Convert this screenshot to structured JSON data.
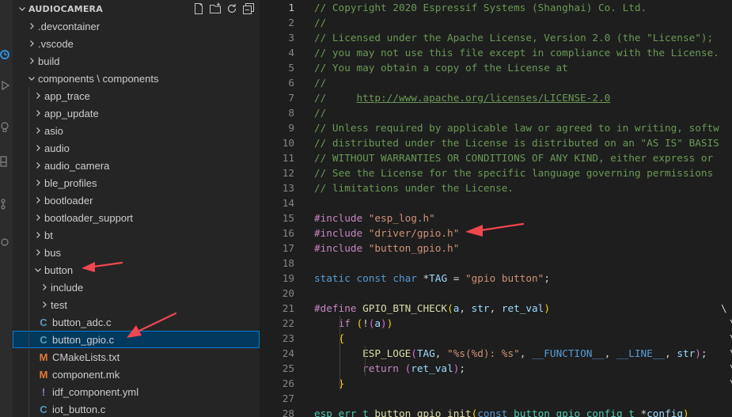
{
  "explorer": {
    "title": "AUDIOCAMERA",
    "actions": [
      "new-file-icon",
      "new-folder-icon",
      "refresh-icon",
      "collapse-all-icon"
    ],
    "items": [
      {
        "label": ".devcontainer",
        "depth": 0,
        "kind": "folder",
        "open": false
      },
      {
        "label": ".vscode",
        "depth": 0,
        "kind": "folder",
        "open": false
      },
      {
        "label": "build",
        "depth": 0,
        "kind": "folder",
        "open": false
      },
      {
        "label": "components \\ components",
        "depth": 0,
        "kind": "folder",
        "open": true
      },
      {
        "label": "app_trace",
        "depth": 1,
        "kind": "folder",
        "open": false
      },
      {
        "label": "app_update",
        "depth": 1,
        "kind": "folder",
        "open": false
      },
      {
        "label": "asio",
        "depth": 1,
        "kind": "folder",
        "open": false
      },
      {
        "label": "audio",
        "depth": 1,
        "kind": "folder",
        "open": false
      },
      {
        "label": "audio_camera",
        "depth": 1,
        "kind": "folder",
        "open": false
      },
      {
        "label": "ble_profiles",
        "depth": 1,
        "kind": "folder",
        "open": false
      },
      {
        "label": "bootloader",
        "depth": 1,
        "kind": "folder",
        "open": false
      },
      {
        "label": "bootloader_support",
        "depth": 1,
        "kind": "folder",
        "open": false
      },
      {
        "label": "bt",
        "depth": 1,
        "kind": "folder",
        "open": false
      },
      {
        "label": "bus",
        "depth": 1,
        "kind": "folder",
        "open": false
      },
      {
        "label": "button",
        "depth": 1,
        "kind": "folder",
        "open": true
      },
      {
        "label": "include",
        "depth": 2,
        "kind": "folder",
        "open": false
      },
      {
        "label": "test",
        "depth": 2,
        "kind": "folder",
        "open": false
      },
      {
        "label": "button_adc.c",
        "depth": 2,
        "kind": "file",
        "icon": "C",
        "icon_color": "#519aba"
      },
      {
        "label": "button_gpio.c",
        "depth": 2,
        "kind": "file",
        "icon": "C",
        "icon_color": "#519aba",
        "selected": true
      },
      {
        "label": "CMakeLists.txt",
        "depth": 2,
        "kind": "file",
        "icon": "M",
        "icon_color": "#e37933"
      },
      {
        "label": "component.mk",
        "depth": 2,
        "kind": "file",
        "icon": "M",
        "icon_color": "#e37933"
      },
      {
        "label": "idf_component.yml",
        "depth": 2,
        "kind": "file",
        "icon": "!",
        "icon_color": "#a074c4"
      },
      {
        "label": "iot_button.c",
        "depth": 2,
        "kind": "file",
        "icon": "C",
        "icon_color": "#519aba"
      }
    ]
  },
  "editor": {
    "active_line": 1,
    "lines": [
      {
        "n": "1",
        "tokens": [
          {
            "t": "// Copyright 2020 Espressif Systems (Shanghai) Co. Ltd.",
            "c": "comment"
          }
        ]
      },
      {
        "n": "2",
        "tokens": [
          {
            "t": "//",
            "c": "comment"
          }
        ]
      },
      {
        "n": "3",
        "tokens": [
          {
            "t": "// Licensed under the Apache License, Version 2.0 (the \"License\");",
            "c": "comment"
          }
        ]
      },
      {
        "n": "4",
        "tokens": [
          {
            "t": "// you may not use this file except in compliance with the License.",
            "c": "comment"
          }
        ]
      },
      {
        "n": "5",
        "tokens": [
          {
            "t": "// You may obtain a copy of the License at",
            "c": "comment"
          }
        ]
      },
      {
        "n": "6",
        "tokens": [
          {
            "t": "//",
            "c": "comment"
          }
        ]
      },
      {
        "n": "7",
        "tokens": [
          {
            "t": "//     ",
            "c": "comment"
          },
          {
            "t": "http://www.apache.org/licenses/LICENSE-2.0",
            "c": "link"
          }
        ]
      },
      {
        "n": "8",
        "tokens": [
          {
            "t": "//",
            "c": "comment"
          }
        ]
      },
      {
        "n": "9",
        "tokens": [
          {
            "t": "// Unless required by applicable law or agreed to in writing, softw",
            "c": "comment"
          }
        ]
      },
      {
        "n": "10",
        "tokens": [
          {
            "t": "// distributed under the License is distributed on an \"AS IS\" BASIS",
            "c": "comment"
          }
        ]
      },
      {
        "n": "11",
        "tokens": [
          {
            "t": "// WITHOUT WARRANTIES OR CONDITIONS OF ANY KIND, either express or",
            "c": "comment"
          }
        ]
      },
      {
        "n": "12",
        "tokens": [
          {
            "t": "// See the License for the specific language governing permissions",
            "c": "comment"
          }
        ]
      },
      {
        "n": "13",
        "tokens": [
          {
            "t": "// limitations under the License.",
            "c": "comment"
          }
        ]
      },
      {
        "n": "14",
        "tokens": []
      },
      {
        "n": "15",
        "tokens": [
          {
            "t": "#include",
            "c": "macro"
          },
          {
            "t": " ",
            "c": "plain"
          },
          {
            "t": "\"esp_log.h\"",
            "c": "string"
          }
        ]
      },
      {
        "n": "16",
        "tokens": [
          {
            "t": "#include",
            "c": "macro"
          },
          {
            "t": " ",
            "c": "plain"
          },
          {
            "t": "\"driver/gpio.h\"",
            "c": "string"
          }
        ]
      },
      {
        "n": "17",
        "tokens": [
          {
            "t": "#include",
            "c": "macro"
          },
          {
            "t": " ",
            "c": "plain"
          },
          {
            "t": "\"button_gpio.h\"",
            "c": "string"
          }
        ]
      },
      {
        "n": "18",
        "tokens": []
      },
      {
        "n": "19",
        "tokens": [
          {
            "t": "static",
            "c": "keyword"
          },
          {
            "t": " ",
            "c": "plain"
          },
          {
            "t": "const",
            "c": "keyword"
          },
          {
            "t": " ",
            "c": "plain"
          },
          {
            "t": "char",
            "c": "keyword"
          },
          {
            "t": " *",
            "c": "plain"
          },
          {
            "t": "TAG",
            "c": "var"
          },
          {
            "t": " = ",
            "c": "plain"
          },
          {
            "t": "\"gpio button\"",
            "c": "string"
          },
          {
            "t": ";",
            "c": "plain"
          }
        ]
      },
      {
        "n": "20",
        "tokens": []
      },
      {
        "n": "21",
        "tokens": [
          {
            "t": "#define",
            "c": "macro"
          },
          {
            "t": " ",
            "c": "plain"
          },
          {
            "t": "GPIO_BTN_CHECK",
            "c": "func"
          },
          {
            "t": "(",
            "c": "bracket1"
          },
          {
            "t": "a",
            "c": "var"
          },
          {
            "t": ", ",
            "c": "plain"
          },
          {
            "t": "str",
            "c": "var"
          },
          {
            "t": ", ",
            "c": "plain"
          },
          {
            "t": "ret_val",
            "c": "var"
          },
          {
            "t": ")",
            "c": "bracket1"
          }
        ]
      },
      {
        "n": "22",
        "tokens": [
          {
            "t": "    ",
            "c": "plain"
          },
          {
            "t": "if",
            "c": "macro"
          },
          {
            "t": " ",
            "c": "plain"
          },
          {
            "t": "(",
            "c": "bracket1"
          },
          {
            "t": "!",
            "c": "plain"
          },
          {
            "t": "(",
            "c": "bracket2"
          },
          {
            "t": "a",
            "c": "var"
          },
          {
            "t": ")",
            "c": "bracket2"
          },
          {
            "t": ")",
            "c": "bracket1"
          }
        ]
      },
      {
        "n": "23",
        "tokens": [
          {
            "t": "    ",
            "c": "plain"
          },
          {
            "t": "{",
            "c": "bracket1"
          }
        ]
      },
      {
        "n": "24",
        "tokens": [
          {
            "t": "        ",
            "c": "plain"
          },
          {
            "t": "ESP_LOGE",
            "c": "func"
          },
          {
            "t": "(",
            "c": "bracket2"
          },
          {
            "t": "TAG",
            "c": "var"
          },
          {
            "t": ", ",
            "c": "plain"
          },
          {
            "t": "\"%s(%d): %s\"",
            "c": "string"
          },
          {
            "t": ", ",
            "c": "plain"
          },
          {
            "t": "__FUNCTION__",
            "c": "keyword"
          },
          {
            "t": ", ",
            "c": "plain"
          },
          {
            "t": "__LINE__",
            "c": "keyword"
          },
          {
            "t": ", ",
            "c": "plain"
          },
          {
            "t": "str",
            "c": "var"
          },
          {
            "t": ")",
            "c": "bracket2"
          },
          {
            "t": ";",
            "c": "plain"
          }
        ]
      },
      {
        "n": "25",
        "tokens": [
          {
            "t": "        ",
            "c": "plain"
          },
          {
            "t": "return",
            "c": "macro"
          },
          {
            "t": " ",
            "c": "plain"
          },
          {
            "t": "(",
            "c": "bracket2"
          },
          {
            "t": "ret_val",
            "c": "var"
          },
          {
            "t": ")",
            "c": "bracket2"
          },
          {
            "t": ";",
            "c": "plain"
          }
        ]
      },
      {
        "n": "26",
        "tokens": [
          {
            "t": "    ",
            "c": "plain"
          },
          {
            "t": "}",
            "c": "bracket1"
          }
        ]
      },
      {
        "n": "27",
        "tokens": []
      },
      {
        "n": "28",
        "tokens": [
          {
            "t": "esp_err_t",
            "c": "type"
          },
          {
            "t": " ",
            "c": "plain"
          },
          {
            "t": "button_gpio_init",
            "c": "func"
          },
          {
            "t": "(",
            "c": "bracket1"
          },
          {
            "t": "const",
            "c": "keyword"
          },
          {
            "t": " ",
            "c": "plain"
          },
          {
            "t": "button_gpio_config_t",
            "c": "type"
          },
          {
            "t": " *",
            "c": "plain"
          },
          {
            "t": "config",
            "c": "var"
          },
          {
            "t": ")",
            "c": "bracket1"
          }
        ]
      }
    ]
  },
  "annotations": {
    "arrow_color": "#f0474f"
  }
}
